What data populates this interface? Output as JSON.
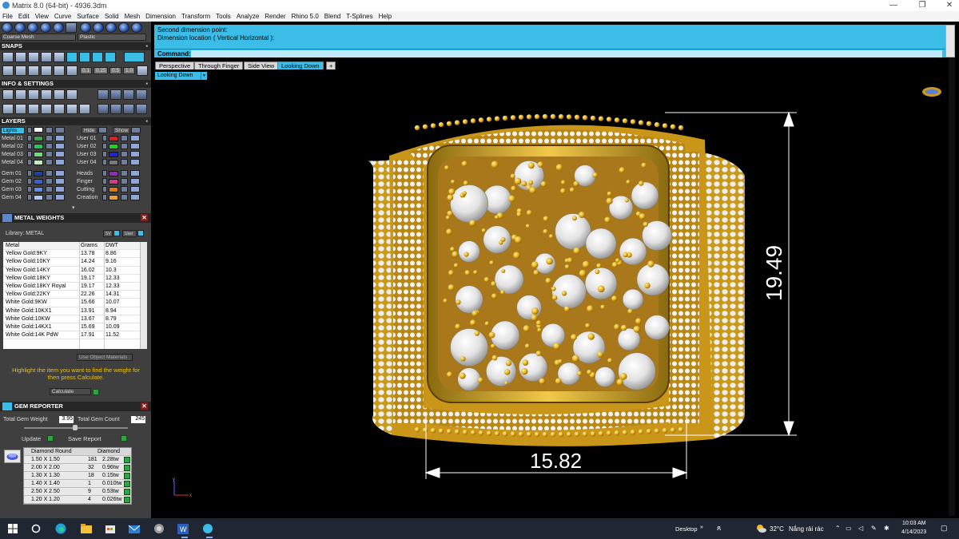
{
  "window": {
    "title": "Matrix 8.0 (64-bit) - 4936.3dm",
    "min_glyph": "—",
    "max_glyph": "❐",
    "close_glyph": "✕"
  },
  "menu": [
    "File",
    "Edit",
    "View",
    "Curve",
    "Surface",
    "Solid",
    "Mesh",
    "Dimension",
    "Transform",
    "Tools",
    "Analyze",
    "Render",
    "Rhino 5.0",
    "Blend",
    "T-Splines",
    "Help"
  ],
  "left_panel": {
    "combo_mesh": "Coarse Mesh",
    "combo_material": "Plastic",
    "snaps_header": "SNAPS",
    "snap_values": [
      "0.1",
      "0.25",
      "0.5",
      "1.0"
    ],
    "info_header": "INFO & SETTINGS",
    "layers_header": "LAYERS",
    "lights_label": "Lights",
    "hide_label": "Hide",
    "show_label": "Show",
    "layers_left": [
      {
        "name": "Metal 01",
        "color": "#3aa64a"
      },
      {
        "name": "Metal 02",
        "color": "#29c45a"
      },
      {
        "name": "Metal 03",
        "color": "#6ae07a"
      },
      {
        "name": "Metal 04",
        "color": "#b7f2c0"
      },
      {
        "name": "Gem 01",
        "color": "#1b3fa8"
      },
      {
        "name": "Gem 02",
        "color": "#2f63d6"
      },
      {
        "name": "Gem 03",
        "color": "#5a8ff0"
      },
      {
        "name": "Gem 04",
        "color": "#a9c8ff"
      }
    ],
    "layers_right": [
      {
        "name": "User 01",
        "color": "#e02020"
      },
      {
        "name": "User 02",
        "color": "#20d020"
      },
      {
        "name": "User 03",
        "color": "#1d25d8"
      },
      {
        "name": "User 04",
        "color": "#7a7a7a"
      },
      {
        "name": "Heads",
        "color": "#8f2bb8"
      },
      {
        "name": "Finger",
        "color": "#d83a8a"
      },
      {
        "name": "Cutting",
        "color": "#e07a10"
      },
      {
        "name": "Creation",
        "color": "#f0a030"
      }
    ],
    "metal_weights": {
      "header": "METAL WEIGHTS",
      "library_label": "Library: METAL",
      "btn_sv": "SV",
      "btn_user": "User",
      "columns": [
        "Metal",
        "Grams",
        "DWT"
      ],
      "rows": [
        [
          "Yellow Gold:9KY",
          "13.78",
          "8.86"
        ],
        [
          "Yellow Gold:10KY",
          "14.24",
          "9.16"
        ],
        [
          "Yellow Gold:14KY",
          "16.02",
          "10.3"
        ],
        [
          "Yellow Gold:18KY",
          "19.17",
          "12.33"
        ],
        [
          "Yellow Gold:18KY Royal",
          "19.17",
          "12.33"
        ],
        [
          "Yellow Gold:22KY",
          "22.26",
          "14.31"
        ],
        [
          "White Gold:9KW",
          "15.66",
          "10.07"
        ],
        [
          "White Gold:10KX1",
          "13.91",
          "8.94"
        ],
        [
          "White Gold:10KW",
          "13.67",
          "8.79"
        ],
        [
          "White Gold:14KX1",
          "15.69",
          "10.09"
        ],
        [
          "White Gold:14K PdW",
          "17.91",
          "11.52"
        ]
      ],
      "use_object_materials": "Use Object Materials",
      "hint": "Highlight the item you want to find the weight for then press Calculate.",
      "calculate": "Calculate"
    },
    "gem_reporter": {
      "header": "GEM REPORTER",
      "total_weight_label": "Total Gem Weight",
      "total_weight": "3.95",
      "total_count_label": "Total Gem Count",
      "total_count": "245",
      "update": "Update",
      "save_report": "Save Report",
      "col_shape": "Diamond Round",
      "col_material": "Diamond",
      "rows": [
        [
          "1.50 X 1.50",
          "181",
          "2.28tw"
        ],
        [
          "2.00 X 2.00",
          "32",
          "0.96tw"
        ],
        [
          "1.30 X 1.30",
          "18",
          "0.15tw"
        ],
        [
          "1.40 X 1.40",
          "1",
          "0.010tw"
        ],
        [
          "2.50 X 2.50",
          "9",
          "0.53tw"
        ],
        [
          "1.20 X 1.20",
          "4",
          "0.026tw"
        ]
      ]
    }
  },
  "command": {
    "line1": "Second dimension point:",
    "line2": "Dimension location ( Vertical  Horizontal ):",
    "prompt": "Command:"
  },
  "viewport_tabs": [
    {
      "label": "Perspective",
      "active": false
    },
    {
      "label": "Through Finger",
      "active": false
    },
    {
      "label": "Side View",
      "active": false
    },
    {
      "label": "Looking Down",
      "active": true
    }
  ],
  "add_tab_glyph": "+",
  "viewport_label": "Looking Down",
  "viewport_label_arrow": "▾",
  "dimensions": {
    "vertical": "19.49",
    "horizontal": "15.82"
  },
  "axis": {
    "y": "y",
    "x": "x"
  },
  "taskbar": {
    "desktop": "Desktop",
    "temperature": "32°C",
    "weather": "Nắng rải rác",
    "time": "10:03 AM",
    "date": "4/14/2023"
  },
  "colors": {
    "accent_blue": "#3cbde8",
    "gold": "#e8b820",
    "panel_bg": "#3f3f3f"
  }
}
